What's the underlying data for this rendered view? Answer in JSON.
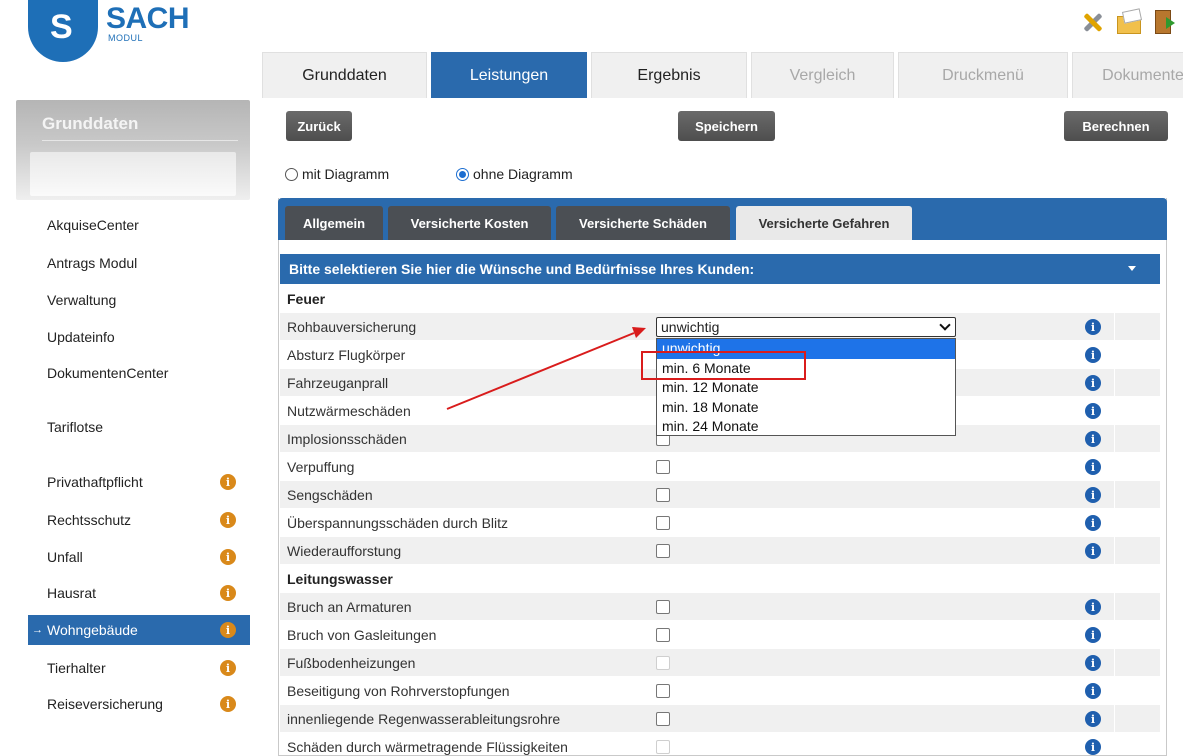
{
  "brand": {
    "logo_letter": "S",
    "name": "SACH",
    "subtitle": "MODUL"
  },
  "tools": [
    "settings-icon",
    "export-icon",
    "exit-icon"
  ],
  "main_tabs": [
    {
      "label": "Grunddaten",
      "state": "normal"
    },
    {
      "label": "Leistungen",
      "state": "active"
    },
    {
      "label": "Ergebnis",
      "state": "normal"
    },
    {
      "label": "Vergleich",
      "state": "disabled"
    },
    {
      "label": "Druckmenü",
      "state": "disabled"
    },
    {
      "label": "Dokumente",
      "state": "disabled"
    }
  ],
  "sidebar": {
    "title": "Grunddaten",
    "items": [
      {
        "label": "AkquiseCenter"
      },
      {
        "label": "Antrags Modul"
      },
      {
        "label": "Verwaltung"
      },
      {
        "label": "Updateinfo"
      },
      {
        "label": "DokumentenCenter"
      },
      {
        "label": "Tariflotse"
      },
      {
        "label": "Privathaftpflicht"
      },
      {
        "label": "Rechtsschutz"
      },
      {
        "label": "Unfall"
      },
      {
        "label": "Hausrat"
      },
      {
        "label": "Wohngebäude"
      },
      {
        "label": "Tierhalter"
      },
      {
        "label": "Reiseversicherung"
      }
    ]
  },
  "toolbar": {
    "back_label": "Zurück",
    "save_label": "Speichern",
    "calc_label": "Berechnen"
  },
  "diagram_options": {
    "with_label": "mit Diagramm",
    "without_label": "ohne Diagramm",
    "selected": "ohne Diagramm"
  },
  "sub_tabs": [
    {
      "label": "Allgemein"
    },
    {
      "label": "Versicherte Kosten"
    },
    {
      "label": "Versicherte Schäden"
    },
    {
      "label": "Versicherte Gefahren",
      "active": true
    }
  ],
  "section_title": "Bitte selektieren Sie hier die Wünsche und Bedürfnisse Ihres Kunden:",
  "rows": [
    {
      "label": "Feuer",
      "type": "group"
    },
    {
      "label": "Rohbauversicherung",
      "type": "select"
    },
    {
      "label": "Absturz Flugkörper",
      "type": "checkbox"
    },
    {
      "label": "Fahrzeuganprall",
      "type": "checkbox"
    },
    {
      "label": "Nutzwärmeschäden",
      "type": "checkbox"
    },
    {
      "label": "Implosionsschäden",
      "type": "checkbox"
    },
    {
      "label": "Verpuffung",
      "type": "checkbox"
    },
    {
      "label": "Sengschäden",
      "type": "checkbox"
    },
    {
      "label": "Überspannungsschäden durch Blitz",
      "type": "checkbox"
    },
    {
      "label": "Wiederaufforstung",
      "type": "checkbox"
    },
    {
      "label": "Leitungswasser",
      "type": "group"
    },
    {
      "label": "Bruch an Armaturen",
      "type": "checkbox"
    },
    {
      "label": "Bruch von Gasleitungen",
      "type": "checkbox"
    },
    {
      "label": "Fußbodenheizungen",
      "type": "checkbox",
      "disabled": true
    },
    {
      "label": "Beseitigung von Rohrverstopfungen",
      "type": "checkbox"
    },
    {
      "label": "innenliegende Regenwasserableitungsrohre",
      "type": "checkbox"
    },
    {
      "label": "Schäden durch wärmetragende Flüssigkeiten",
      "type": "checkbox",
      "disabled": true
    }
  ],
  "select": {
    "value": "unwichtig",
    "options": [
      "unwichtig",
      "min. 6 Monate",
      "min. 12 Monate",
      "min. 18 Monate",
      "min. 24 Monate"
    ],
    "highlighted": "unwichtig",
    "annotated": "min. 6 Monate"
  },
  "colors": {
    "primary": "#2a6aad",
    "annotation": "#d91c1c",
    "info_blue": "#1f5fae",
    "info_orange": "#d9891a"
  }
}
